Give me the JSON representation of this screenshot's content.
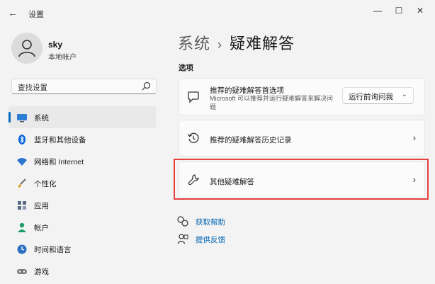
{
  "window": {
    "title": "设置",
    "back_icon": "back-arrow-icon"
  },
  "user": {
    "name": "sky",
    "account_type": "本地帐户"
  },
  "search": {
    "placeholder": "查找设置"
  },
  "nav": {
    "items": [
      {
        "label": "系统",
        "icon": "monitor-icon",
        "active": true
      },
      {
        "label": "蓝牙和其他设备",
        "icon": "bluetooth-icon"
      },
      {
        "label": "网络和 Internet",
        "icon": "wifi-icon"
      },
      {
        "label": "个性化",
        "icon": "brush-icon"
      },
      {
        "label": "应用",
        "icon": "apps-icon"
      },
      {
        "label": "帐户",
        "icon": "person-icon"
      },
      {
        "label": "时间和语言",
        "icon": "clock-globe-icon"
      },
      {
        "label": "游戏",
        "icon": "gamepad-icon"
      }
    ]
  },
  "breadcrumb": {
    "parent": "系统",
    "separator": "›",
    "current": "疑难解答"
  },
  "section": {
    "label": "选项"
  },
  "cards": {
    "recommended_prefs": {
      "title": "推荐的疑难解答首选项",
      "description": "Microsoft 可以推荐并运行疑难解答来解决问题",
      "dropdown_value": "运行前询问我"
    },
    "history": {
      "title": "推荐的疑难解答历史记录"
    },
    "other": {
      "title": "其他疑难解答"
    }
  },
  "links": {
    "help": "获取帮助",
    "feedback": "提供反馈"
  },
  "colors": {
    "accent": "#0067c0",
    "highlight_border": "#e8403f",
    "link": "#0063b1"
  }
}
